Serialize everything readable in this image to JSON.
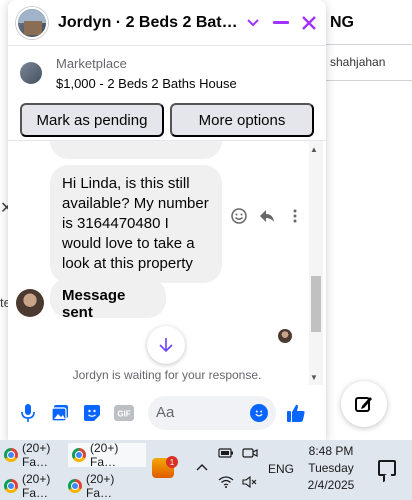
{
  "background": {
    "header_fragment": "NG",
    "name_fragment": "shahjahan",
    "side_fragment": "te"
  },
  "chat": {
    "title": "Jordyn · 2 Beds 2 Baths Ho…",
    "marketplace_label": "Marketplace",
    "listing": "$1,000 - 2 Beds 2 Baths House",
    "buttons": {
      "mark_pending": "Mark as pending",
      "more_options": "More options"
    },
    "messages": [
      {
        "text": "Hi Linda, is this still available? My number is 3164470480 I would love to take a look at this property"
      },
      {
        "text": "Message sent"
      }
    ],
    "waiting_text": "Jordyn is waiting for your response.",
    "composer": {
      "placeholder": "Aa",
      "gif_label": "GIF"
    }
  },
  "taskbar": {
    "items": [
      {
        "label": "(20+) Fa…"
      },
      {
        "label": "(20+) Fa…"
      },
      {
        "label": "(20+) Fa…"
      },
      {
        "label": "(20+) Fa…"
      }
    ],
    "badge_count": "1",
    "language": "ENG",
    "time": "8:48 PM",
    "day": "Tuesday",
    "date": "2/4/2025"
  },
  "colors": {
    "accent": "#a033ff",
    "messenger_blue": "#0866ff",
    "bubble": "#f0f0f0",
    "button_bg": "#e4e6eb"
  }
}
